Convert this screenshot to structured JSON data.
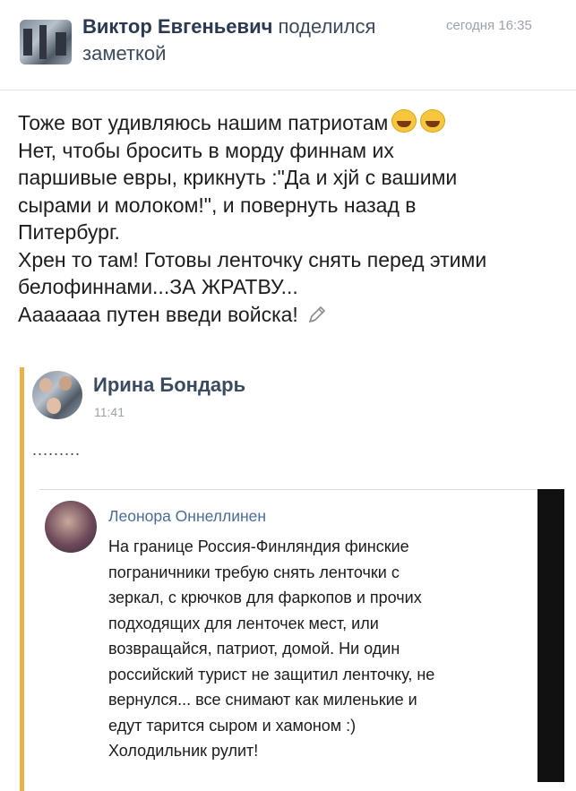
{
  "post": {
    "author": "Виктор Евгеньевич",
    "action_line1": "поделился",
    "action_line2": "заметкой",
    "time": "сегодня 16:35",
    "lines": [
      "Тоже вот удивляюсь нашим патриотам",
      "Нет, чтобы бросить в морду финнам их",
      "паршивые евры, крикнуть :\"Да и хјй с вашими",
      "сырами и молоком!\", и повернуть назад в",
      "Питербург.",
      "Хрен то там! Готовы ленточку снять перед этими",
      "белофиннами...ЗА ЖРАТВУ...",
      "Ааааааа путен введи войска!"
    ]
  },
  "shared": {
    "author": "Ирина Бондарь",
    "time": "11:41",
    "text": "........."
  },
  "screenshot": {
    "author": "Леонора Оннеллинен",
    "lines": [
      "На границе Россия-Финляндия финские",
      "пограничники требую снять ленточки с",
      "зеркал, с крючков для фаркопов и прочих",
      "подходящих для ленточек мест, или",
      "возвращайся, патриот, домой. Ни один",
      "российский турист не защитил ленточку, не",
      "вернулся... все снимают как миленькие и",
      "едут тарится сыром и хамоном :)",
      "Холодильник рулит!"
    ]
  },
  "icons": {
    "emoji": "laughing-emoji-icon",
    "edit": "pencil-icon"
  },
  "colors": {
    "accent_bar": "#e8b24a",
    "link_name": "#4b6b95"
  }
}
